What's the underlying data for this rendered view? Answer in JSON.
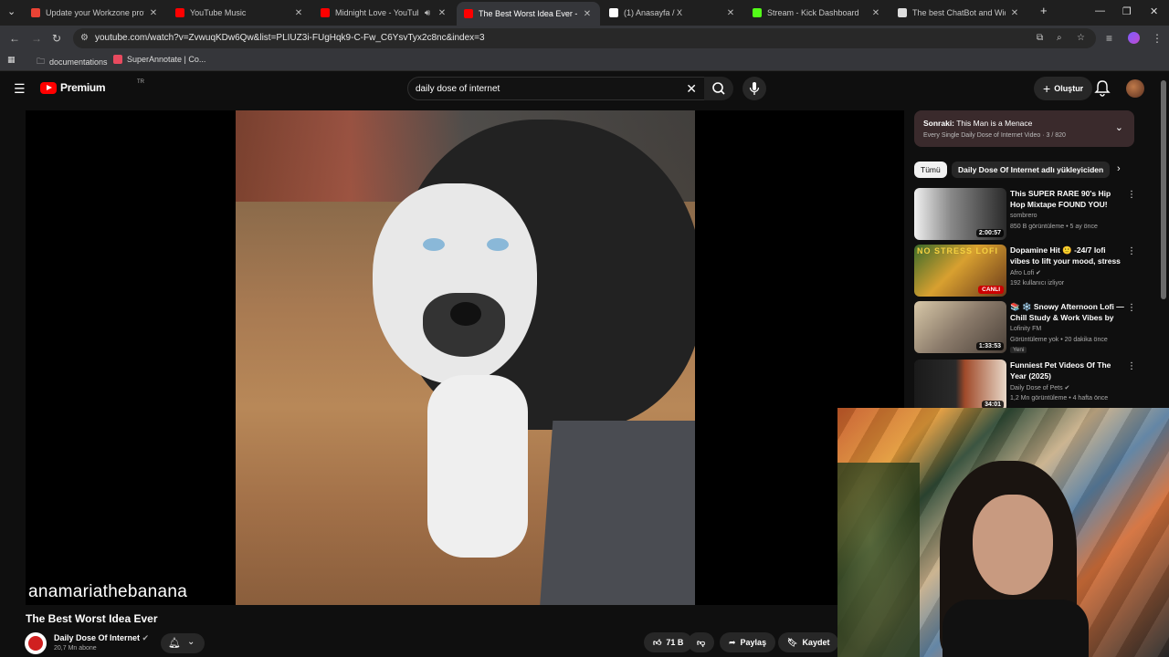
{
  "browser": {
    "tabs": [
      {
        "title": "Update your Workzone profile",
        "favicon_color": "#ea4335",
        "active": false
      },
      {
        "title": "YouTube Music",
        "favicon_color": "#ff0000",
        "active": false
      },
      {
        "title": "Midnight Love - YouTube",
        "favicon_color": "#ff0000",
        "active": false,
        "audio": true
      },
      {
        "title": "The Best Worst Idea Ever - You",
        "favicon_color": "#ff0000",
        "active": true
      },
      {
        "title": "(1) Anasayfa / X",
        "favicon_color": "#ffffff",
        "active": false
      },
      {
        "title": "Stream - Kick Dashboard",
        "favicon_color": "#53fc18",
        "active": false
      },
      {
        "title": "The best ChatBot and Widgets",
        "favicon_color": "#dddddd",
        "active": false
      }
    ],
    "url": "youtube.com/watch?v=ZvwuqKDw6Qw&list=PLIUZ3i-FUgHqk9-C-Fw_C6YsvTyx2c8nc&index=3",
    "bookmarks": [
      {
        "label": "documentations",
        "icon": "folder-icon"
      },
      {
        "label": "SuperAnnotate | Co...",
        "icon": "superannotate-icon"
      }
    ]
  },
  "youtube": {
    "logo_text": "Premium",
    "logo_region": "TR",
    "search_value": "daily dose of internet",
    "create_label": "Oluştur",
    "video": {
      "watermark": "anamariathebanana",
      "title": "The Best Worst Idea Ever",
      "channel": "Daily Dose Of Internet",
      "subscribers": "20,7 Mn abone",
      "likes": "71 B",
      "share_label": "Paylaş",
      "save_label": "Kaydet"
    },
    "up_next": {
      "prefix": "Sonraki:",
      "title": "This Man is a Menace",
      "subtitle": "Every Single Daily Dose of Internet Video · 3 / 820"
    },
    "chips": {
      "all": "Tümü",
      "channel": "Daily Dose Of Internet adlı yükleyiciden"
    },
    "recommendations": [
      {
        "title": "This SUPER RARE 90's Hip Hop Mixtape FOUND YOU!",
        "channel": "sombrero",
        "meta": "850 B görüntüleme • 5 ay önce",
        "duration": "2:00:57"
      },
      {
        "title": "Dopamine Hit 🙂 -24/7 lofi vibes to lift your mood, stress ...",
        "channel": "Afro Lofi",
        "meta": "192 kullanıcı izliyor",
        "live": "CANLI"
      },
      {
        "title": "📚 ❄️ Snowy Afternoon Lofi — Chill Study & Work Vibes by th...",
        "channel": "Lofinity FM",
        "meta": "Görüntüleme yok • 20 dakika önce",
        "badge": "Yeni",
        "duration": "1:33:53"
      },
      {
        "title": "Funniest Pet Videos Of The Year (2025)",
        "channel": "Daily Dose of Pets",
        "meta": "1,2 Mn görüntüleme • 4 hafta önce",
        "duration": "34:01"
      }
    ]
  }
}
